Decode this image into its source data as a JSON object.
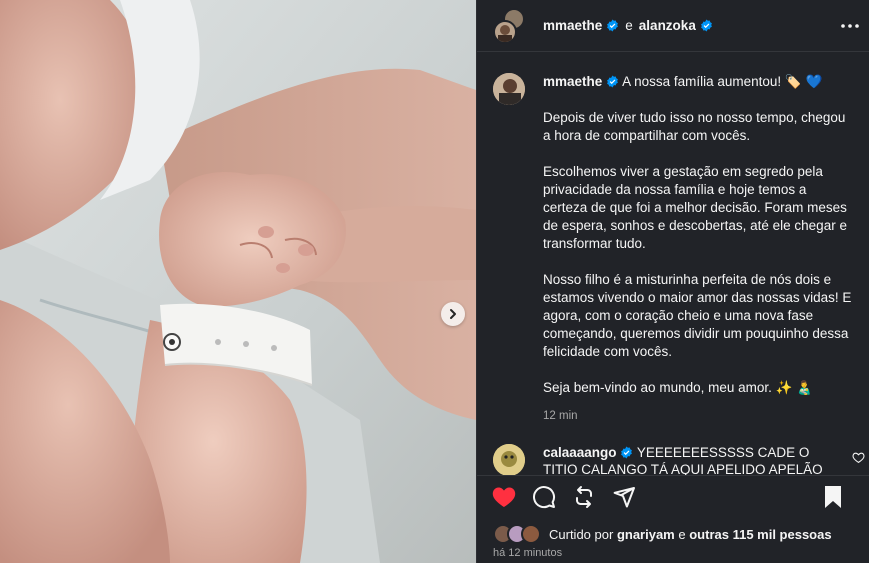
{
  "colors": {
    "panel_bg": "#212328",
    "text": "#f5f5f5",
    "muted": "#a8a8a8",
    "verified_blue": "#0095f6",
    "like_red": "#ff3040"
  },
  "header": {
    "user1": "mmaethe",
    "conjunction": "e",
    "user2": "alanzoka",
    "more_icon": "more-horizontal-icon"
  },
  "caption": {
    "username": "mmaethe",
    "headline": "A nossa família aumentou! 🏷️ 💙",
    "paragraphs": [
      "Depois de viver tudo isso no nosso tempo, chegou a hora de compartilhar com vocês.",
      "Escolhemos viver a gestação em segredo pela privacidade da nossa família e hoje temos a certeza de que foi a melhor decisão. Foram meses de espera, sonhos e descobertas, até ele chegar e transformar tudo.",
      "Nosso filho é a misturinha perfeita de nós dois e estamos vivendo o maior amor das nossas vidas! E agora, com o coração cheio e uma nova fase começando, queremos dividir um pouquinho dessa felicidade com vocês.",
      "Seja bem-vindo ao mundo, meu amor. ✨ 👨‍🍼"
    ],
    "time": "12 min"
  },
  "comment": {
    "username": "calaaaango",
    "text": "YEEEEEEESSSSS CADE O TITIO CALANGO TÁ AQUI APELIDO APELÃO"
  },
  "footer": {
    "liked_prefix": "Curtido por",
    "liked_user": "gnariyam",
    "liked_middle": "e",
    "liked_others": "outras 115 mil pessoas",
    "time_ago": "há 12 minutos"
  }
}
